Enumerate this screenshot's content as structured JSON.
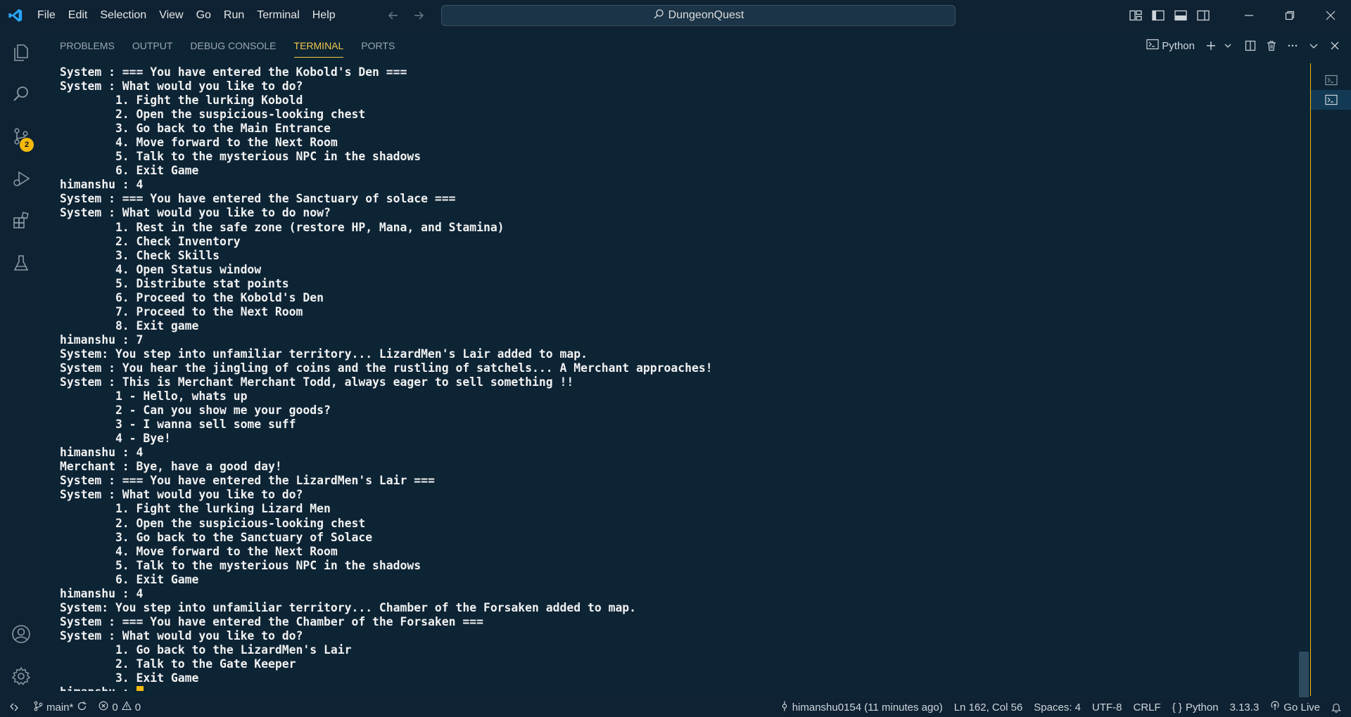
{
  "menu": [
    "File",
    "Edit",
    "Selection",
    "View",
    "Go",
    "Run",
    "Terminal",
    "Help"
  ],
  "command_center": {
    "label": "DungeonQuest"
  },
  "activity": {
    "source_control_badge": "2"
  },
  "panel": {
    "tabs": [
      "PROBLEMS",
      "OUTPUT",
      "DEBUG CONSOLE",
      "TERMINAL",
      "PORTS"
    ],
    "active_tab": "TERMINAL",
    "terminal_profile": "Python"
  },
  "terminal": {
    "lines": [
      "System : === You have entered the Kobold's Den ===",
      "System : What would you like to do?",
      "        1. Fight the lurking Kobold",
      "        2. Open the suspicious-looking chest",
      "        3. Go back to the Main Entrance",
      "        4. Move forward to the Next Room",
      "        5. Talk to the mysterious NPC in the shadows",
      "        6. Exit Game",
      "himanshu : 4",
      "System : === You have entered the Sanctuary of solace ===",
      "System : What would you like to do now?",
      "        1. Rest in the safe zone (restore HP, Mana, and Stamina)",
      "        2. Check Inventory",
      "        3. Check Skills",
      "        4. Open Status window",
      "        5. Distribute stat points",
      "        6. Proceed to the Kobold's Den",
      "        7. Proceed to the Next Room",
      "        8. Exit game",
      "himanshu : 7",
      "System: You step into unfamiliar territory... LizardMen's Lair added to map.",
      "System : You hear the jingling of coins and the rustling of satchels... A Merchant approaches!",
      "System : This is Merchant Merchant Todd, always eager to sell something !!",
      "        1 - Hello, whats up",
      "        2 - Can you show me your goods?",
      "        3 - I wanna sell some suff",
      "        4 - Bye!",
      "himanshu : 4",
      "Merchant : Bye, have a good day!",
      "System : === You have entered the LizardMen's Lair ===",
      "System : What would you like to do?",
      "        1. Fight the lurking Lizard Men",
      "        2. Open the suspicious-looking chest",
      "        3. Go back to the Sanctuary of Solace",
      "        4. Move forward to the Next Room",
      "        5. Talk to the mysterious NPC in the shadows",
      "        6. Exit Game",
      "himanshu : 4",
      "System: You step into unfamiliar territory... Chamber of the Forsaken added to map.",
      "System : === You have entered the Chamber of the Forsaken ===",
      "System : What would you like to do?",
      "        1. Go back to the LizardMen's Lair",
      "        2. Talk to the Gate Keeper",
      "        3. Exit Game"
    ],
    "prompt": "himanshu : "
  },
  "statusbar": {
    "branch": "main*",
    "errors": "0",
    "warnings": "0",
    "blame": "himanshu0154 (11 minutes ago)",
    "position": "Ln 162, Col 56",
    "spaces": "Spaces: 4",
    "encoding": "UTF-8",
    "eol": "CRLF",
    "language": "Python",
    "python_version": "3.13.3",
    "go_live": "Go Live"
  },
  "colors": {
    "background": "#0d2435",
    "accent": "#f2b90d",
    "text": "#f2f2f2"
  }
}
